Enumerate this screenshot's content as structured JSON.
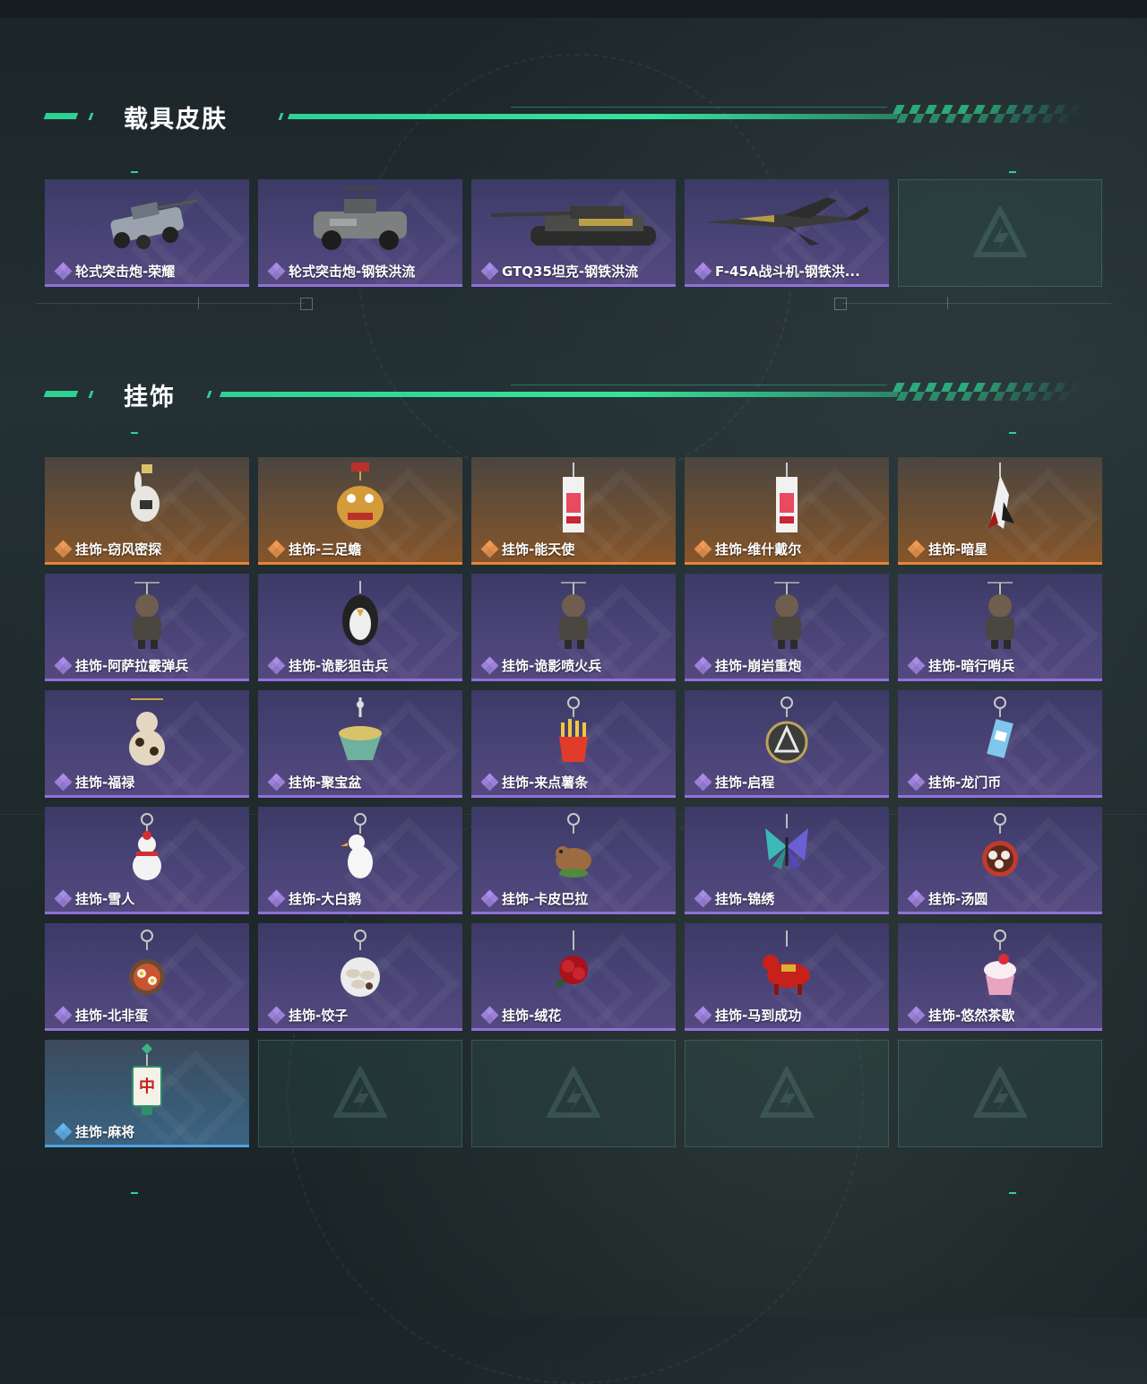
{
  "sections": {
    "vehicle": {
      "title": "载具皮肤",
      "items": [
        {
          "label": "轮式突击炮-荣耀",
          "rarity": "purple",
          "icon": "wheeled-assault-vehicle-icon"
        },
        {
          "label": "轮式突击炮-钢铁洪流",
          "rarity": "purple",
          "icon": "armored-car-icon"
        },
        {
          "label": "GTQ35坦克-钢铁洪流",
          "rarity": "purple",
          "icon": "tank-icon"
        },
        {
          "label": "F-45A战斗机-钢铁洪...",
          "rarity": "purple",
          "icon": "fighter-jet-icon"
        },
        {
          "label": "",
          "rarity": "empty",
          "icon": "empty-slot-logo-icon"
        }
      ]
    },
    "charms": {
      "title": "挂饰",
      "items": [
        {
          "label": "挂饰-窃风密探",
          "rarity": "gold",
          "icon": "rabbit-charm-icon"
        },
        {
          "label": "挂饰-三足蟾",
          "rarity": "gold",
          "icon": "golden-toad-charm-icon"
        },
        {
          "label": "挂饰-能天使",
          "rarity": "gold",
          "icon": "card-charm-icon"
        },
        {
          "label": "挂饰-维什戴尔",
          "rarity": "gold",
          "icon": "card-charm-icon"
        },
        {
          "label": "挂饰-暗星",
          "rarity": "gold",
          "icon": "crane-charm-icon"
        },
        {
          "label": "挂饰-阿萨拉霰弹兵",
          "rarity": "purple",
          "icon": "soldier-charm-icon"
        },
        {
          "label": "挂饰-诡影狙击兵",
          "rarity": "purple",
          "icon": "penguin-soldier-charm-icon"
        },
        {
          "label": "挂饰-诡影喷火兵",
          "rarity": "purple",
          "icon": "soldier-charm-icon"
        },
        {
          "label": "挂饰-崩岩重炮",
          "rarity": "purple",
          "icon": "soldier-charm-icon"
        },
        {
          "label": "挂饰-暗行哨兵",
          "rarity": "purple",
          "icon": "soldier-charm-icon"
        },
        {
          "label": "挂饰-福禄",
          "rarity": "purple",
          "icon": "gourd-charm-icon"
        },
        {
          "label": "挂饰-聚宝盆",
          "rarity": "purple",
          "icon": "treasure-bowl-charm-icon"
        },
        {
          "label": "挂饰-来点薯条",
          "rarity": "purple",
          "icon": "fries-charm-icon"
        },
        {
          "label": "挂饰-启程",
          "rarity": "purple",
          "icon": "emblem-charm-icon"
        },
        {
          "label": "挂饰-龙门币",
          "rarity": "purple",
          "icon": "coin-card-charm-icon"
        },
        {
          "label": "挂饰-雪人",
          "rarity": "purple",
          "icon": "snowman-charm-icon"
        },
        {
          "label": "挂饰-大白鹅",
          "rarity": "purple",
          "icon": "goose-charm-icon"
        },
        {
          "label": "挂饰-卡皮巴拉",
          "rarity": "purple",
          "icon": "capybara-charm-icon"
        },
        {
          "label": "挂饰-锦绣",
          "rarity": "purple",
          "icon": "butterfly-charm-icon"
        },
        {
          "label": "挂饰-汤圆",
          "rarity": "purple",
          "icon": "rice-ball-bowl-charm-icon"
        },
        {
          "label": "挂饰-北非蛋",
          "rarity": "purple",
          "icon": "egg-dish-charm-icon"
        },
        {
          "label": "挂饰-饺子",
          "rarity": "purple",
          "icon": "dumpling-plate-charm-icon"
        },
        {
          "label": "挂饰-绒花",
          "rarity": "purple",
          "icon": "velvet-flower-charm-icon"
        },
        {
          "label": "挂饰-马到成功",
          "rarity": "purple",
          "icon": "horse-charm-icon"
        },
        {
          "label": "挂饰-悠然茶歇",
          "rarity": "purple",
          "icon": "cupcake-charm-icon"
        },
        {
          "label": "挂饰-麻将",
          "rarity": "blue",
          "icon": "mahjong-tile-charm-icon"
        },
        {
          "label": "",
          "rarity": "empty",
          "icon": "empty-slot-logo-icon"
        },
        {
          "label": "",
          "rarity": "empty",
          "icon": "empty-slot-logo-icon"
        },
        {
          "label": "",
          "rarity": "empty",
          "icon": "empty-slot-logo-icon"
        },
        {
          "label": "",
          "rarity": "empty",
          "icon": "empty-slot-logo-icon"
        }
      ]
    }
  },
  "mahjong_tile_text": "中",
  "colors": {
    "accent": "#2fd192",
    "purple_rarity": "#9170dc",
    "gold_rarity": "#e9833a",
    "blue_rarity": "#4fa3e3"
  }
}
